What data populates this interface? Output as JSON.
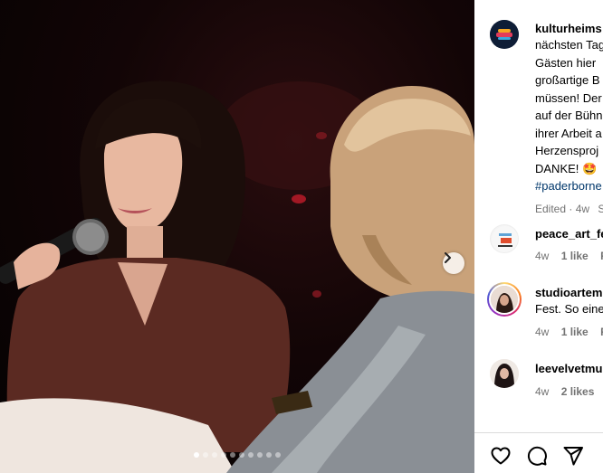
{
  "post": {
    "username": "kulturheims",
    "caption_lines": [
      "nächsten Tag",
      "Gästen hier",
      "großartige B",
      "müssen! Der",
      "auf der Bühn",
      "ihrer Arbeit a",
      "Herzensproj",
      "DANKE! 🤩"
    ],
    "hashtag": "#paderborne",
    "edited": "Edited · 4w",
    "edited_extra": "S"
  },
  "carousel": {
    "slides": 10,
    "active_index": 0
  },
  "comments": [
    {
      "username": "peace_art_fe",
      "age": "4w",
      "likes": "1 like",
      "reply": "Re"
    },
    {
      "username": "studioartem",
      "text": "Fest. So eine",
      "age": "4w",
      "likes": "1 like",
      "reply": "Re"
    },
    {
      "username": "leevelvetmu",
      "age": "4w",
      "likes": "2 likes",
      "reply": "Re"
    }
  ],
  "icons": {
    "next": "chevron-right-icon",
    "like": "heart-icon",
    "comment": "comment-bubble-icon",
    "share": "paper-plane-icon"
  },
  "colors": {
    "link": "#00376b",
    "meta": "#737373",
    "story_ring": "#d62976"
  }
}
